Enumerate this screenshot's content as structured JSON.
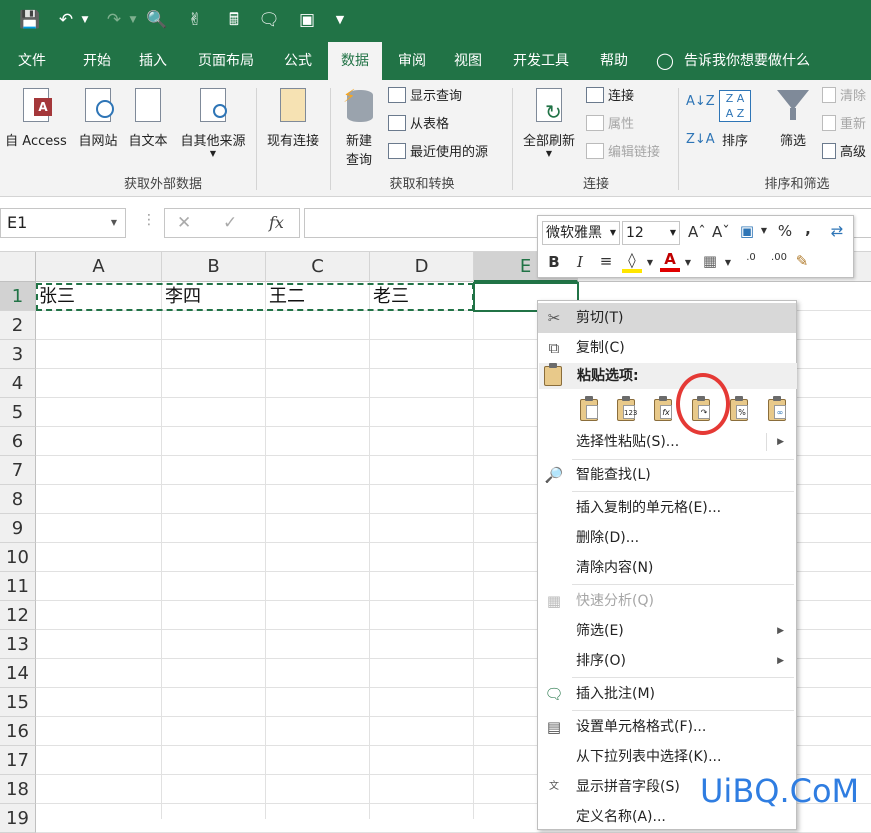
{
  "colors": {
    "accent": "#217346",
    "ring": "#e53935",
    "watermark": "#2f7de1"
  },
  "qat": {
    "icons": [
      "save-icon",
      "undo-icon",
      "redo-icon",
      "print-preview-icon",
      "touch-mode-icon",
      "calculator-icon",
      "comment-icon",
      "slide-icon",
      "customize-icon"
    ]
  },
  "tabs": [
    "文件",
    "开始",
    "插入",
    "页面布局",
    "公式",
    "数据",
    "审阅",
    "视图",
    "开发工具",
    "帮助"
  ],
  "tellme": "告诉我你想要做什么",
  "ribbon": {
    "get_external": {
      "access": "自 Access",
      "web": "自网站",
      "text": "自文本",
      "other": "自其他来源",
      "existing": "现有连接",
      "label": "获取外部数据"
    },
    "transform": {
      "new_query_1": "新建",
      "new_query_2": "查询",
      "show_queries": "显示查询",
      "from_table": "从表格",
      "recent": "最近使用的源",
      "label": "获取和转换"
    },
    "connections": {
      "refresh": "全部刷新",
      "connections": "连接",
      "properties": "属性",
      "edit_links": "编辑链接",
      "label": "连接"
    },
    "sort": {
      "sort": "排序",
      "filter": "筛选",
      "clear": "清除",
      "reapply": "重新",
      "advanced": "高级",
      "label": "排序和筛选"
    }
  },
  "formula": {
    "namebox": "E1",
    "fx": "fx"
  },
  "grid": {
    "columns": [
      "A",
      "B",
      "C",
      "D",
      "E"
    ],
    "rows": [
      "1",
      "2",
      "3",
      "4",
      "5",
      "6",
      "7",
      "8",
      "9",
      "10",
      "11",
      "12",
      "13",
      "14",
      "15",
      "16",
      "17",
      "18",
      "19"
    ],
    "row1": [
      "张三",
      "李四",
      "王二",
      "老三"
    ]
  },
  "mini": {
    "font": "微软雅黑",
    "size": "12",
    "bold": "B",
    "italic": "I",
    "percent": "%",
    "comma": ",",
    "dec_more": ".0",
    "dec_less": ".00"
  },
  "menu": {
    "cut": "剪切(T)",
    "copy": "复制(C)",
    "paste_options": "粘贴选项:",
    "paste_special": "选择性粘贴(S)...",
    "smart_lookup": "智能查找(L)",
    "insert_copied": "插入复制的单元格(E)...",
    "delete": "删除(D)...",
    "clear": "清除内容(N)",
    "quick_analysis": "快速分析(Q)",
    "filter": "筛选(E)",
    "sort": "排序(O)",
    "insert_comment": "插入批注(M)",
    "format_cells": "设置单元格格式(F)...",
    "pick_list": "从下拉列表中选择(K)...",
    "phonetic": "显示拼音字段(S)",
    "define_name": "定义名称(A)..."
  },
  "watermark": "UiBQ.CoM"
}
